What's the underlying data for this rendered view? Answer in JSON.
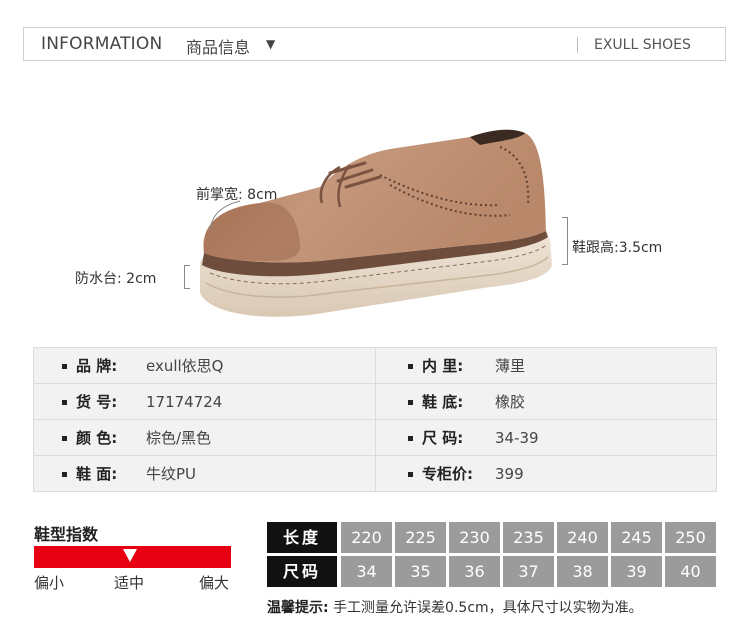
{
  "header": {
    "title": "INFORMATION",
    "title_cn": "商品信息",
    "arrow": "▼",
    "brand": "EXULL SHOES"
  },
  "annotations": {
    "forefoot_width": "前掌宽: 8cm",
    "platform": "防水台: 2cm",
    "heel_height": "鞋跟高:3.5cm"
  },
  "specs": {
    "left": [
      {
        "key": "品 牌:",
        "value": "exull依思Q"
      },
      {
        "key": "货 号:",
        "value": "17174724"
      },
      {
        "key": "颜 色:",
        "value": "棕色/黑色"
      },
      {
        "key": "鞋 面:",
        "value": "牛纹PU"
      }
    ],
    "right": [
      {
        "key": "内 里:",
        "value": "薄里"
      },
      {
        "key": "鞋 底:",
        "value": "橡胶"
      },
      {
        "key": "尺 码:",
        "value": "34-39"
      },
      {
        "key": "专柜价:",
        "value": "399"
      }
    ]
  },
  "fit": {
    "title": "鞋型指数",
    "labels": [
      "偏小",
      "适中",
      "偏大"
    ],
    "level": 0.5,
    "bar_color": "#e60012"
  },
  "size_table": {
    "length_label": "长度",
    "size_label": "尺码",
    "lengths": [
      "220",
      "225",
      "230",
      "235",
      "240",
      "245",
      "250"
    ],
    "sizes": [
      "34",
      "35",
      "36",
      "37",
      "38",
      "39",
      "40"
    ]
  },
  "note": {
    "label": "温馨提示:",
    "text": "手工测量允许误差0.5cm，具体尺寸以实物为准。"
  },
  "colors": {
    "shoe_upper": "#b07e62",
    "sole": "#e8dccd"
  }
}
